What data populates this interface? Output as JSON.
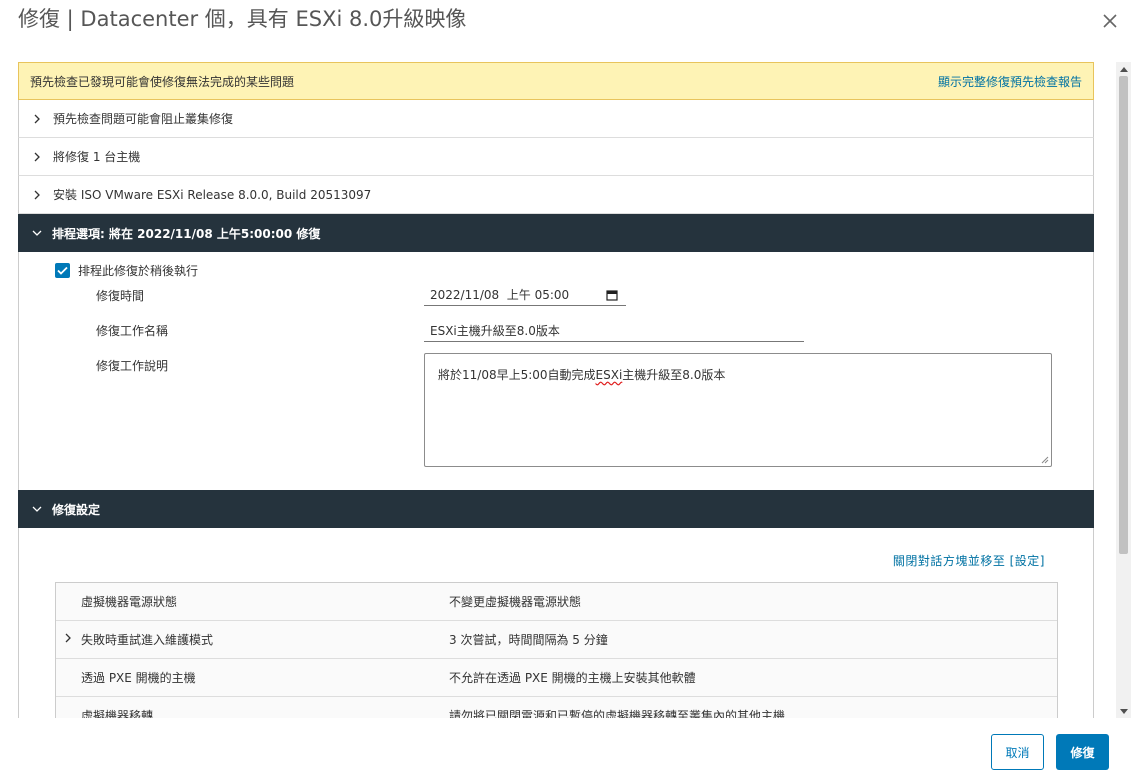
{
  "dialog": {
    "title": "修復 | Datacenter 個，具有 ESXi 8.0升級映像",
    "close_icon": "close-icon"
  },
  "warning": {
    "message": "預先檢查已發現可能會使修復無法完成的某些問題",
    "link": "顯示完整修復預先檢查報告"
  },
  "sections": {
    "precheck_issues": "預先檢查問題可能會阻止叢集修復",
    "hosts": "將修復 1 台主機",
    "install_iso": "安裝 ISO VMware ESXi Release 8.0.0, Build 20513097",
    "schedule_header": "排程選項: 將在 2022/11/08 上午5:00:00 修復",
    "settings_header": "修復設定"
  },
  "schedule": {
    "checkbox_label": "排程此修復於稍後執行",
    "checkbox_checked": true,
    "time_label": "修復時間",
    "time_value": "2022/11/08  上午 05:00",
    "name_label": "修復工作名稱",
    "name_value": "ESXi主機升級至8.0版本",
    "desc_label": "修復工作說明",
    "desc_value_prefix": "將於11/08早上5:00自動完成",
    "desc_value_spell": "ESXi",
    "desc_value_suffix": "主機升級至8.0版本"
  },
  "settings": {
    "move_link": "關閉對話方塊並移至 [設定]",
    "rows": [
      {
        "label": "虛擬機器電源狀態",
        "value": "不變更虛擬機器電源狀態",
        "expandable": false
      },
      {
        "label": "失敗時重試進入維護模式",
        "value": "3 次嘗試，時間間隔為 5 分鐘",
        "expandable": true
      },
      {
        "label": "透過 PXE 開機的主機",
        "value": "不允許在透過 PXE 開機的主機上安裝其他軟體",
        "expandable": false
      },
      {
        "label": "虛擬機器移轉",
        "value": "請勿將已關閉電源和已暫停的虛擬機器移轉至叢集內的其他主機",
        "expandable": false
      }
    ]
  },
  "footer": {
    "cancel": "取消",
    "ok": "修復"
  },
  "colors": {
    "primary": "#0079b8",
    "dark_header": "#25333d",
    "warning_bg": "#fef3b5",
    "warning_border": "#e8c45c",
    "link": "#0072a3"
  }
}
